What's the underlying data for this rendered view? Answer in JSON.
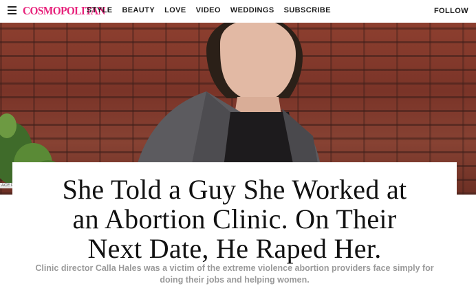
{
  "brand": {
    "logo_text": "COSMOPOLITAN",
    "logo_color": "#e7227b"
  },
  "nav": {
    "links": [
      "STYLE",
      "BEAUTY",
      "LOVE",
      "VIDEO",
      "WEDDINGS",
      "SUBSCRIBE"
    ],
    "follow_label": "FOLLOW",
    "menu_icon": "hamburger-menu-icon"
  },
  "hero": {
    "caption_chip": "ACE PR"
  },
  "article": {
    "headline_lines": [
      "She Told a Guy She Worked at",
      "an Abortion Clinic. On Their",
      "Next Date, He Raped Her."
    ],
    "dek_lines": [
      "Clinic director Calla Hales was a victim of the extreme violence abortion providers face simply for",
      "doing their jobs and helping women."
    ]
  }
}
